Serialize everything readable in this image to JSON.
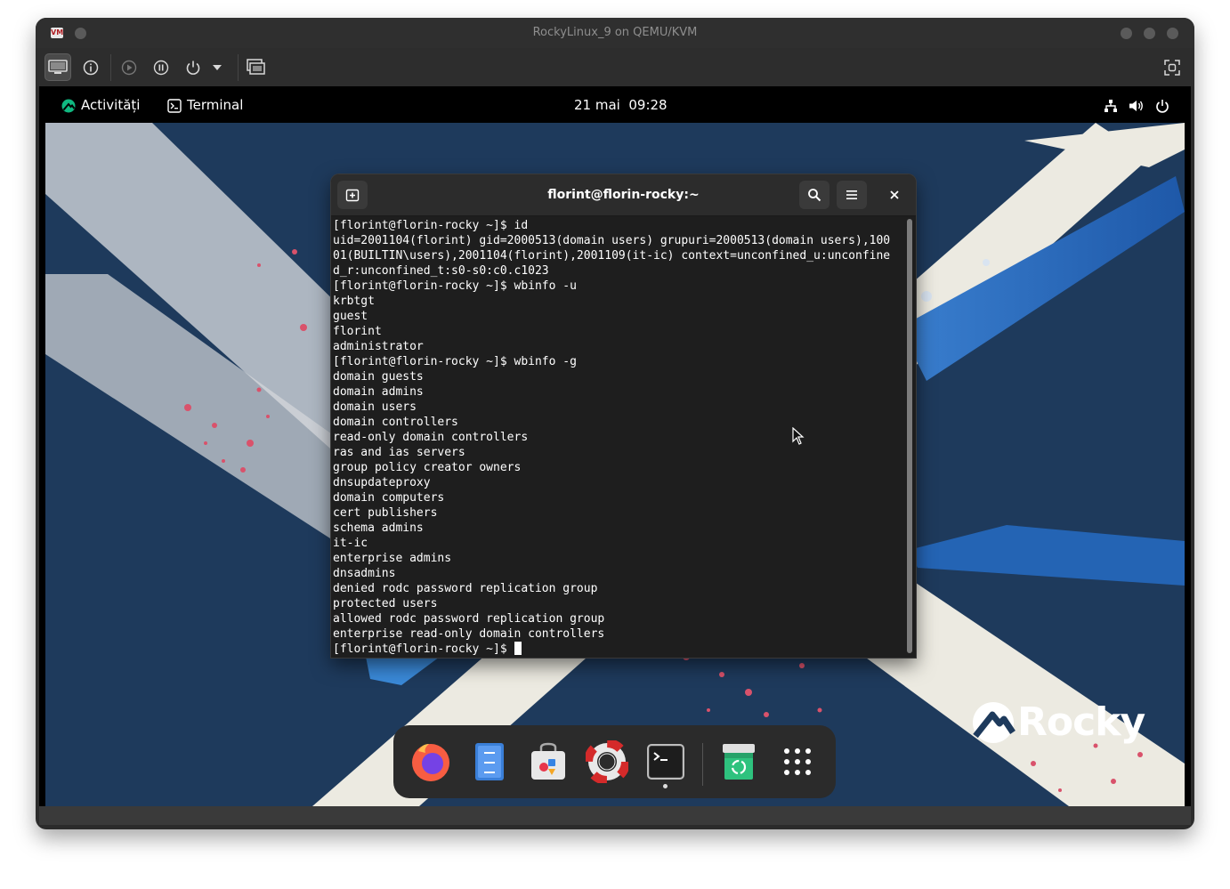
{
  "host_window": {
    "title": "RockyLinux_9 on QEMU/KVM",
    "app_icon_text": "VM"
  },
  "toolbar": {
    "buttons": [
      "display-icon",
      "info-icon",
      "play-icon",
      "pause-icon",
      "power-icon",
      "dropdown-icon",
      "snapshots-icon",
      "fullscreen-icon"
    ]
  },
  "gnome_topbar": {
    "activities": "Activități",
    "app_name": "Terminal",
    "clock": "21 mai  09:28"
  },
  "terminal": {
    "title": "florint@florin-rocky:~",
    "lines": [
      "[florint@florin-rocky ~]$ id",
      "uid=2001104(florint) gid=2000513(domain users) grupuri=2000513(domain users),100",
      "01(BUILTIN\\users),2001104(florint),2001109(it-ic) context=unconfined_u:unconfine",
      "d_r:unconfined_t:s0-s0:c0.c1023",
      "[florint@florin-rocky ~]$ wbinfo -u",
      "krbtgt",
      "guest",
      "florint",
      "administrator",
      "[florint@florin-rocky ~]$ wbinfo -g",
      "domain guests",
      "domain admins",
      "domain users",
      "domain controllers",
      "read-only domain controllers",
      "ras and ias servers",
      "group policy creator owners",
      "dnsupdateproxy",
      "domain computers",
      "cert publishers",
      "schema admins",
      "it-ic",
      "enterprise admins",
      "dnsadmins",
      "denied rodc password replication group",
      "protected users",
      "allowed rodc password replication group",
      "enterprise read-only domain controllers"
    ],
    "prompt": "[florint@florin-rocky ~]$ "
  },
  "dock": {
    "apps": [
      "firefox-icon",
      "files-icon",
      "software-icon",
      "help-icon",
      "terminal-icon",
      "trash-icon",
      "app-grid-icon"
    ]
  },
  "branding": {
    "wordmark": "Rocky"
  },
  "colors": {
    "desktop_bg": "#1e3a5c",
    "rocky_green": "#10b981",
    "terminal_bg": "#1e1e1e"
  }
}
